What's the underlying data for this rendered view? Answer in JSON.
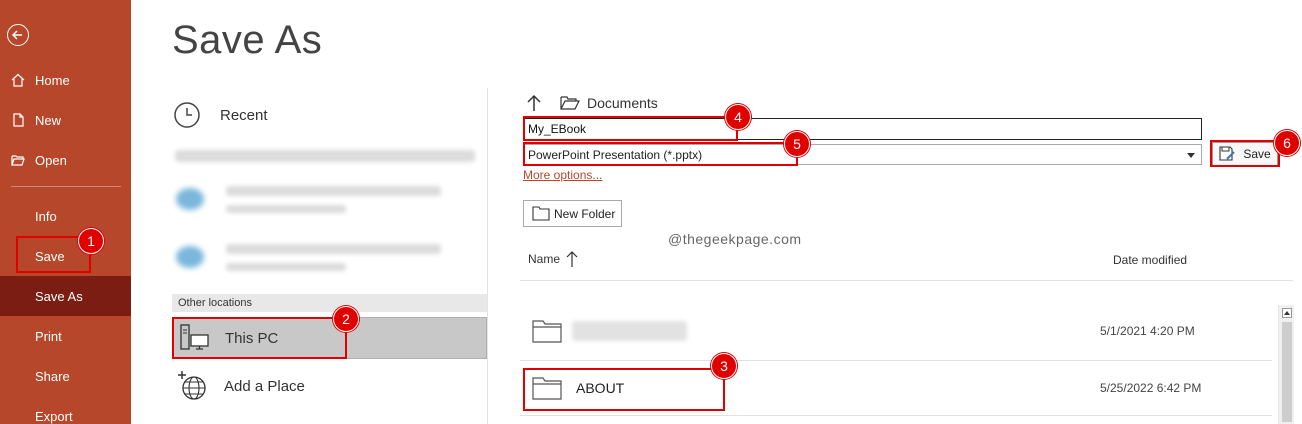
{
  "sidebar": {
    "items": [
      {
        "label": "Home"
      },
      {
        "label": "New"
      },
      {
        "label": "Open"
      },
      {
        "label": "Info"
      },
      {
        "label": "Save"
      },
      {
        "label": "Save As"
      },
      {
        "label": "Print"
      },
      {
        "label": "Share"
      },
      {
        "label": "Export"
      }
    ],
    "bg_color": "#b7472a",
    "active_color": "#7c1d13"
  },
  "page_title": "Save As",
  "locations": {
    "recent": "Recent",
    "section_header": "Other locations",
    "this_pc": "This PC",
    "add_place": "Add a Place"
  },
  "file_panel": {
    "current_folder": "Documents",
    "file_name": "My_EBook",
    "file_type": "PowerPoint Presentation (*.pptx)",
    "more_options": "More options...",
    "save_label": "Save",
    "new_folder_label": "New Folder",
    "watermark": "@thegeekpage.com",
    "columns": {
      "name": "Name",
      "date": "Date modified"
    },
    "rows": [
      {
        "name": "",
        "date": "5/1/2021 4:20 PM"
      },
      {
        "name": "ABOUT",
        "date": "5/25/2022 6:42 PM"
      }
    ]
  },
  "annotations": [
    "1",
    "2",
    "3",
    "4",
    "5",
    "6"
  ],
  "annotation_color": "#e00000"
}
